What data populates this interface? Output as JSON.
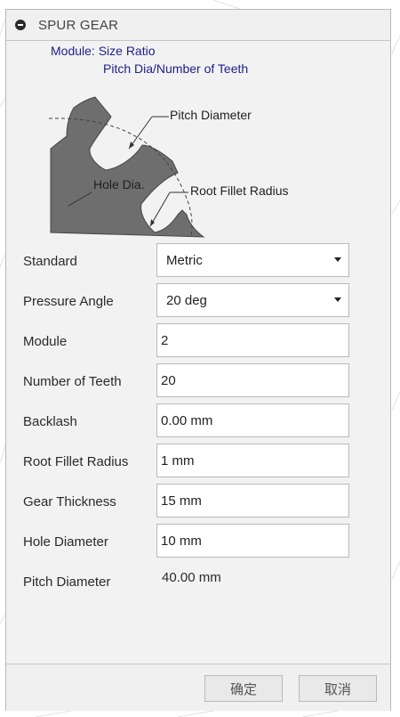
{
  "panel": {
    "title": "SPUR GEAR",
    "collapse_icon": "minus-circle-icon"
  },
  "module_note": {
    "line1": "Module: Size Ratio",
    "line2": "Pitch Dia/Number of Teeth"
  },
  "diagram": {
    "pitch_diameter_label": "Pitch Diameter",
    "hole_dia_label": "Hole Dia.",
    "root_fillet_label": "Root Fillet Radius",
    "gear_fill": "#6e6e6e",
    "note_color": "#20208a"
  },
  "form": {
    "standard": {
      "label": "Standard",
      "value": "Metric"
    },
    "pressure_angle": {
      "label": "Pressure Angle",
      "value": "20 deg"
    },
    "module": {
      "label": "Module",
      "value": "2"
    },
    "number_of_teeth": {
      "label": "Number of Teeth",
      "value": "20"
    },
    "backlash": {
      "label": "Backlash",
      "value": "0.00 mm"
    },
    "root_fillet_radius": {
      "label": "Root Fillet Radius",
      "value": "1 mm"
    },
    "gear_thickness": {
      "label": "Gear Thickness",
      "value": "15 mm"
    },
    "hole_diameter": {
      "label": "Hole Diameter",
      "value": "10 mm"
    },
    "pitch_diameter": {
      "label": "Pitch Diameter",
      "value": "40.00 mm"
    }
  },
  "footer": {
    "ok_label": "确定",
    "cancel_label": "取消"
  }
}
